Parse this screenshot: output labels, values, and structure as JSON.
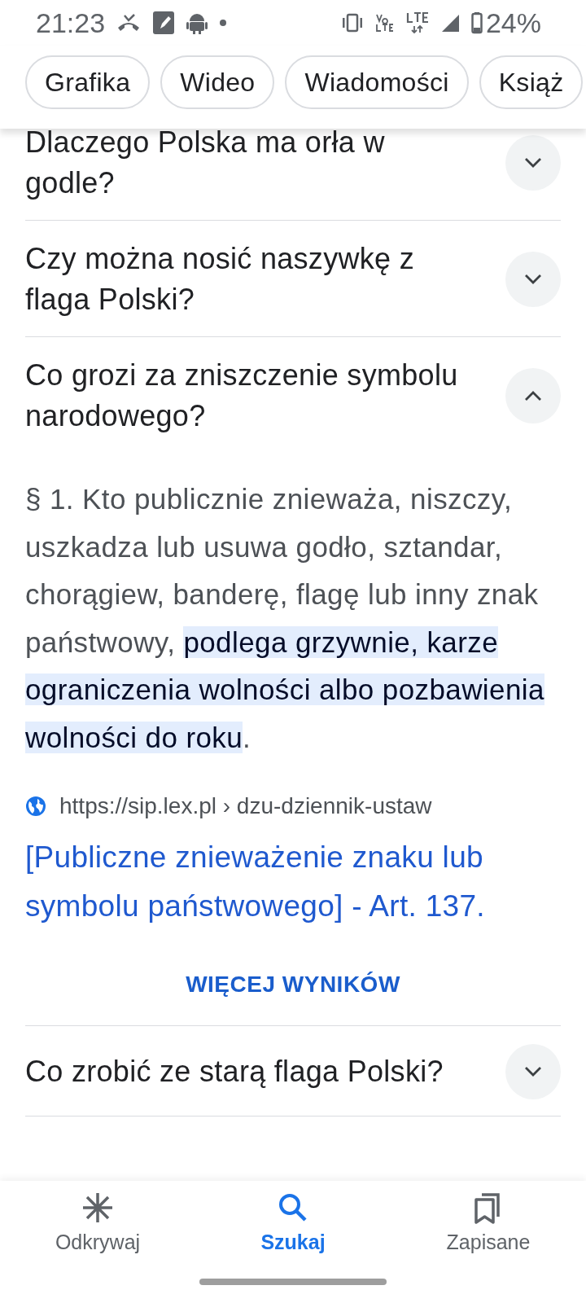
{
  "status_bar": {
    "time": "21:23",
    "battery": "24%"
  },
  "chips": [
    {
      "label": "Grafika"
    },
    {
      "label": "Wideo"
    },
    {
      "label": "Wiadomości"
    },
    {
      "label": "Książ"
    }
  ],
  "questions": [
    {
      "question": "Dlaczego Polska ma orła w godle?",
      "expanded": false
    },
    {
      "question": "Czy można nosić naszywkę z flaga Polski?",
      "expanded": false
    },
    {
      "question": "Co grozi za zniszczenie symbolu narodowego?",
      "expanded": true,
      "answer": {
        "text_before": "§ 1. Kto publicznie znieważa, niszczy, uszkadza lub usuwa godło, sztandar, chorągiew, banderę, flagę lub inny znak państwowy, ",
        "highlight": "podlega grzywnie, karze ograniczenia wolności albo pozbawienia wolności do roku",
        "text_after": "."
      },
      "source": "https://sip.lex.pl › dzu-dziennik-ustaw",
      "link": "[Publiczne znieważenie znaku lub symbolu państwowego] - Art. 137.",
      "more": "WIĘCEJ WYNIKÓW"
    },
    {
      "question": "Co zrobić ze starą flaga Polski?",
      "expanded": false
    }
  ],
  "bottom_nav": [
    {
      "label": "Odkrywaj",
      "selected": false
    },
    {
      "label": "Szukaj",
      "selected": true
    },
    {
      "label": "Zapisane",
      "selected": false
    }
  ]
}
